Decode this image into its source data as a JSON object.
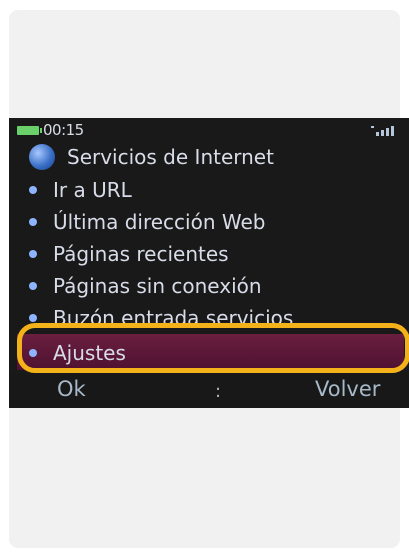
{
  "status": {
    "time": "00:15"
  },
  "menu": {
    "title": "Servicios de Internet",
    "items": [
      {
        "label": "Ir a URL"
      },
      {
        "label": "Última dirección Web"
      },
      {
        "label": "Páginas recientes"
      },
      {
        "label": "Páginas sin conexión"
      },
      {
        "label": "Buzón entrada servicios"
      },
      {
        "label": "Ajustes",
        "selected": true
      }
    ]
  },
  "softkeys": {
    "left": "Ok",
    "center": ":",
    "right": "Volver"
  },
  "colors": {
    "highlight": "#f4b21a",
    "selected_bg": "#5b163a"
  }
}
